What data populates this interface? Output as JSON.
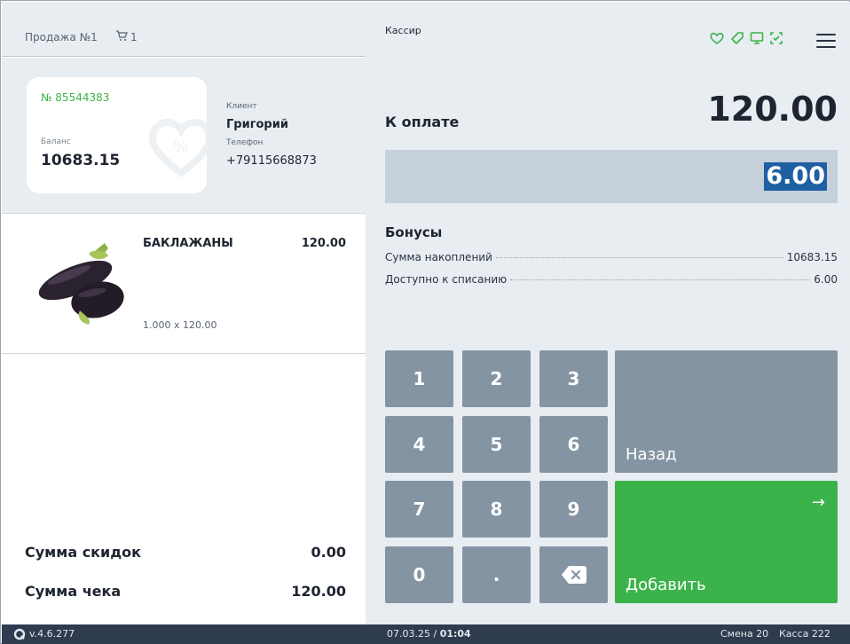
{
  "sale": {
    "title": "Продажа №1",
    "cart_count": "1"
  },
  "card": {
    "number": "№ 85544383",
    "balance_label": "Баланс",
    "balance": "10683.15"
  },
  "client": {
    "label": "Клиент",
    "name": "Григорий",
    "phone_label": "Телефон",
    "phone": "+79115668873"
  },
  "item": {
    "name": "БАКЛАЖАНЫ",
    "price": "120.00",
    "qty": "1.000 x 120.00"
  },
  "totals": {
    "discount_label": "Сумма скидок",
    "discount_value": "0.00",
    "check_label": "Сумма чека",
    "check_value": "120.00"
  },
  "header": {
    "cashier": "Кассир"
  },
  "payment": {
    "to_pay_label": "К оплате",
    "to_pay_value": "120.00",
    "input_value": "6.00"
  },
  "bonus": {
    "title": "Бонусы",
    "rows": [
      {
        "label": "Сумма накоплений",
        "value": "10683.15"
      },
      {
        "label": "Доступно к списанию",
        "value": "6.00"
      }
    ]
  },
  "keypad": {
    "keys": [
      "1",
      "2",
      "3",
      "4",
      "5",
      "6",
      "7",
      "8",
      "9",
      "0",
      "."
    ],
    "back_label": "Назад",
    "add_label": "Добавить",
    "add_arrow": "→"
  },
  "status": {
    "version": "v.4.6.277",
    "date": "07.03.25",
    "time": "01:04",
    "shift": "Смена 20",
    "register": "Касса 222"
  },
  "colors": {
    "accent": "#3bb34a",
    "keys": "#8594a3",
    "panel": "#e8edf2",
    "statusbar": "#2f3b4f",
    "selection": "#1f5fa3"
  },
  "icons": [
    "cart-icon",
    "heart-icon",
    "tag-icon",
    "monitor-icon",
    "scan-icon",
    "menu-icon",
    "backspace-icon",
    "arrow-right-icon",
    "app-logo-icon"
  ]
}
